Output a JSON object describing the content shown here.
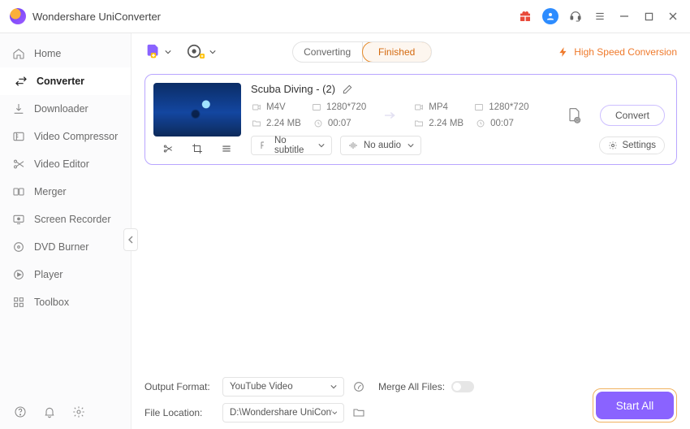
{
  "app": {
    "title": "Wondershare UniConverter"
  },
  "sidebar": {
    "items": [
      {
        "label": "Home"
      },
      {
        "label": "Converter"
      },
      {
        "label": "Downloader"
      },
      {
        "label": "Video Compressor"
      },
      {
        "label": "Video Editor"
      },
      {
        "label": "Merger"
      },
      {
        "label": "Screen Recorder"
      },
      {
        "label": "DVD Burner"
      },
      {
        "label": "Player"
      },
      {
        "label": "Toolbox"
      }
    ]
  },
  "toolbar": {
    "tabs": {
      "converting": "Converting",
      "finished": "Finished"
    },
    "highspeed": "High Speed Conversion"
  },
  "file": {
    "title": "Scuba Diving - (2)",
    "src": {
      "format": "M4V",
      "resolution": "1280*720",
      "size": "2.24 MB",
      "duration": "00:07"
    },
    "dst": {
      "format": "MP4",
      "resolution": "1280*720",
      "size": "2.24 MB",
      "duration": "00:07"
    },
    "subtitle": "No subtitle",
    "audio": "No audio",
    "settings_label": "Settings",
    "convert_label": "Convert"
  },
  "footer": {
    "output_format_label": "Output Format:",
    "output_format_value": "YouTube Video",
    "file_location_label": "File Location:",
    "file_location_value": "D:\\Wondershare UniConverter",
    "merge_label": "Merge All Files:",
    "start_label": "Start All"
  }
}
